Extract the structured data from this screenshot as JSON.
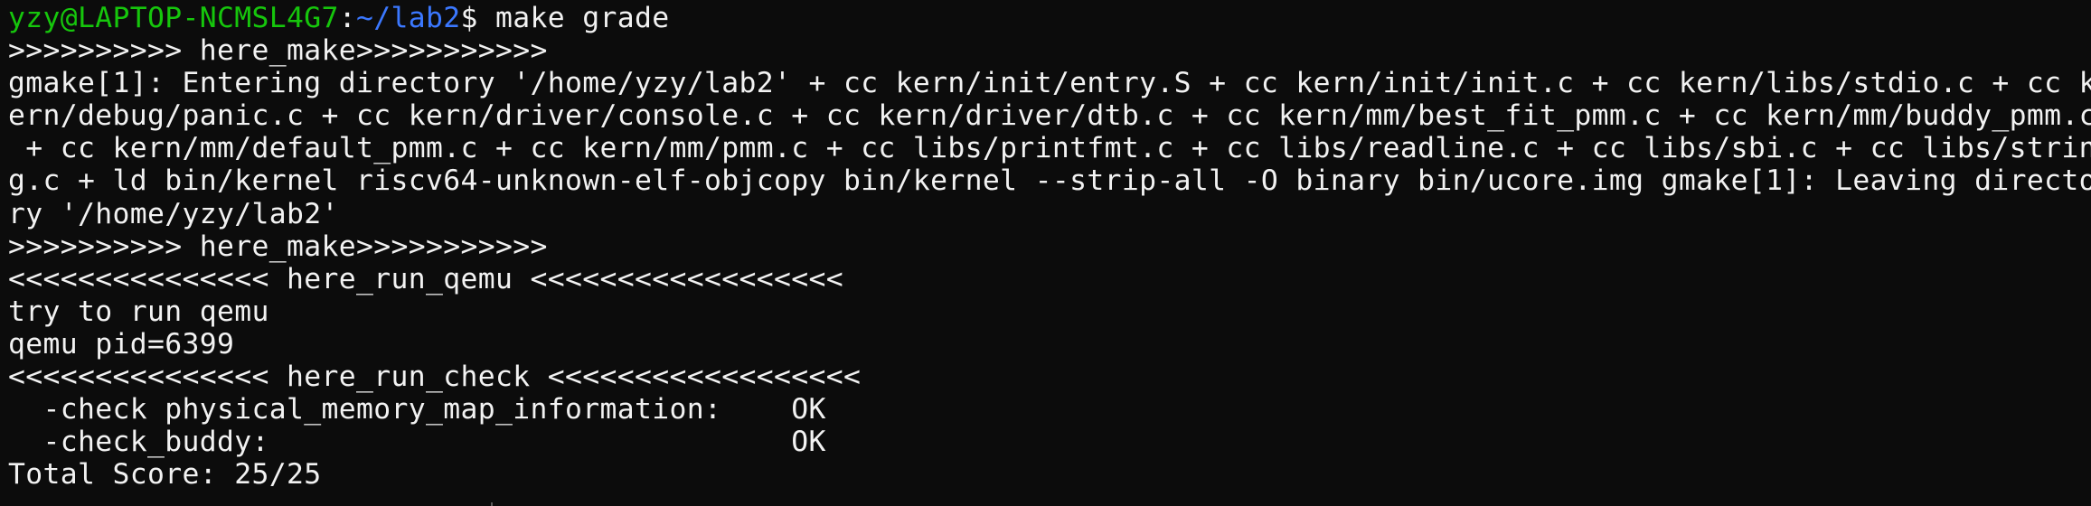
{
  "prompt": {
    "user_host": "yzy@LAPTOP-NCMSL4G7",
    "separator": ":",
    "path": "~/lab2",
    "dollar": "$ ",
    "command": "make grade"
  },
  "output_lines": [
    ">>>>>>>>>> here_make>>>>>>>>>>>",
    "gmake[1]: Entering directory '/home/yzy/lab2' + cc kern/init/entry.S + cc kern/init/init.c + cc kern/libs/stdio.c + cc k",
    "ern/debug/panic.c + cc kern/driver/console.c + cc kern/driver/dtb.c + cc kern/mm/best_fit_pmm.c + cc kern/mm/buddy_pmm.c",
    " + cc kern/mm/default_pmm.c + cc kern/mm/pmm.c + cc libs/printfmt.c + cc libs/readline.c + cc libs/sbi.c + cc libs/strin",
    "g.c + ld bin/kernel riscv64-unknown-elf-objcopy bin/kernel --strip-all -O binary bin/ucore.img gmake[1]: Leaving directo",
    "ry '/home/yzy/lab2'",
    ">>>>>>>>>> here_make>>>>>>>>>>>",
    "<<<<<<<<<<<<<<< here_run_qemu <<<<<<<<<<<<<<<<<<",
    "try to run qemu",
    "qemu pid=6399",
    "<<<<<<<<<<<<<<< here_run_check <<<<<<<<<<<<<<<<<<",
    "  -check physical_memory_map_information:    OK",
    "  -check_buddy:                              OK",
    "Total Score: 25/25"
  ],
  "colors": {
    "background": "#0c0c0c",
    "foreground": "#f2f2f2",
    "prompt_user": "#16c60c",
    "prompt_path": "#3b78ff"
  }
}
